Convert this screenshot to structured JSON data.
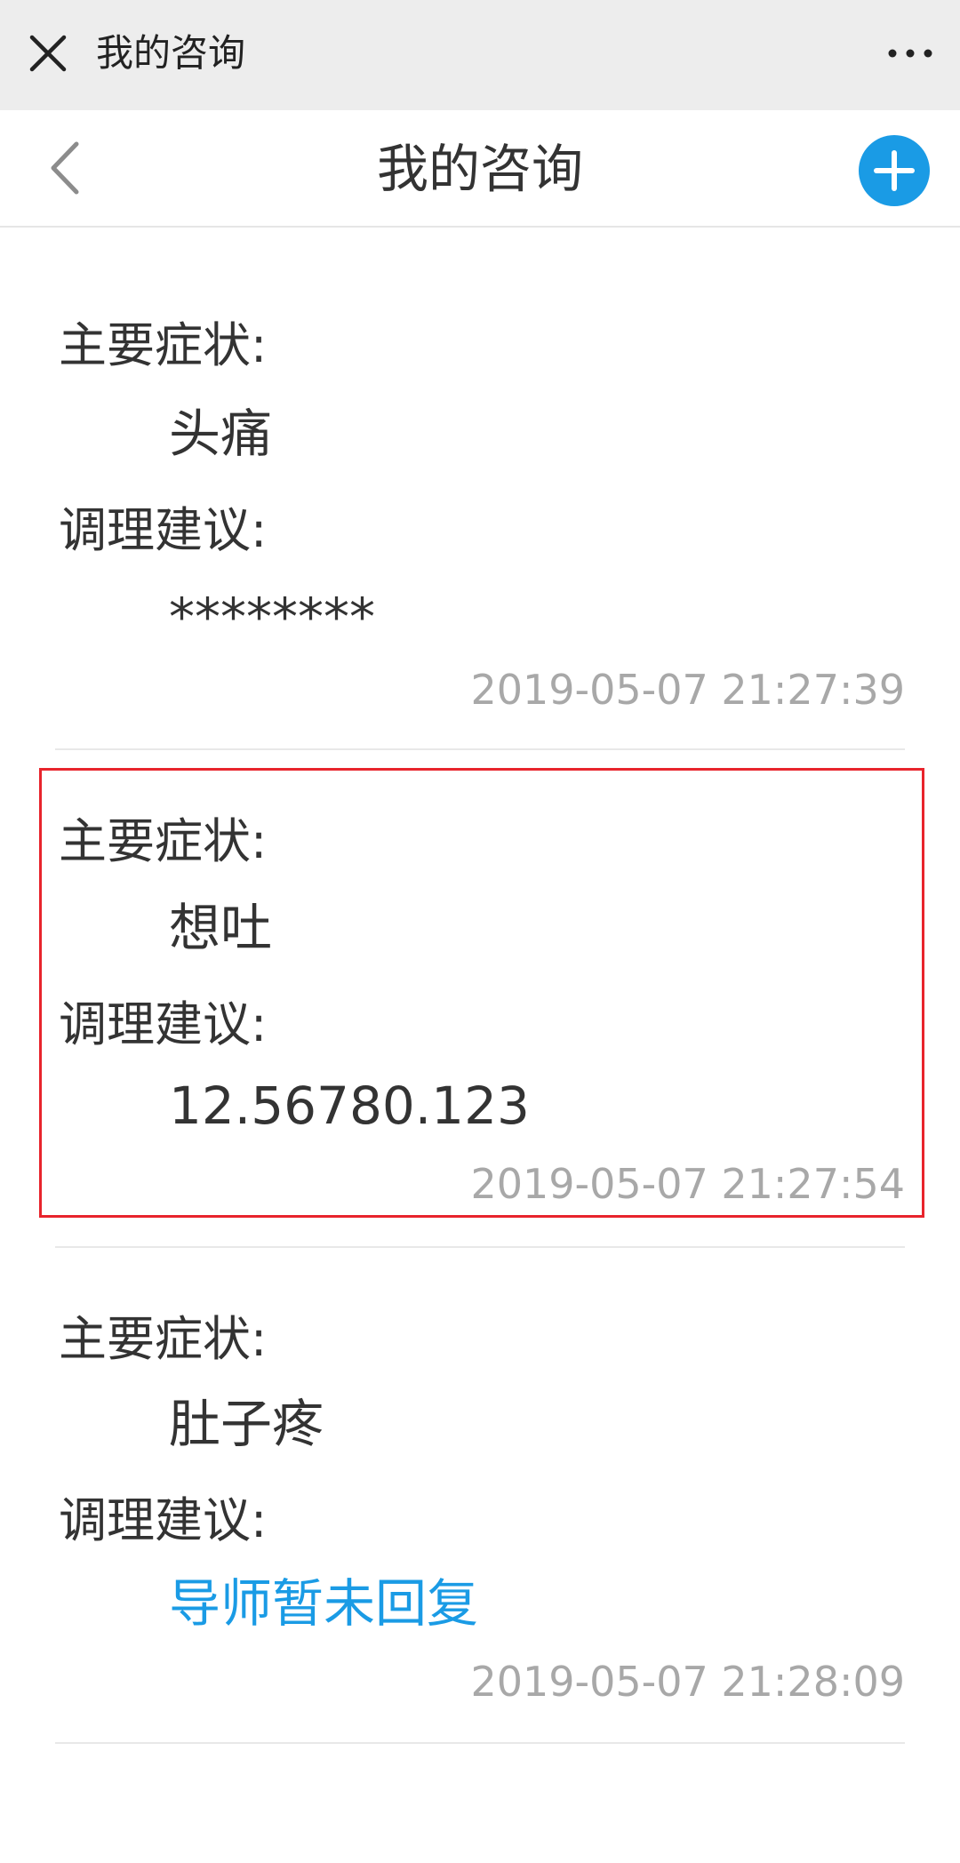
{
  "system_bar": {
    "title": "我的咨询",
    "close_icon": "close-icon",
    "more_icon": "more-dots-icon"
  },
  "header": {
    "title": "我的咨询",
    "back_icon": "chevron-left-icon",
    "add_icon": "plus-circle-icon"
  },
  "colors": {
    "accent": "#1a9be5",
    "highlight": "#e8242c",
    "timestamp": "#a8a8a8"
  },
  "records": [
    {
      "symptom_label": "主要症状:",
      "symptom": "头痛",
      "advice_label": "调理建议:",
      "advice": "********",
      "time": "2019-05-07 21:27:39"
    },
    {
      "symptom_label": "主要症状:",
      "symptom": "想吐",
      "advice_label": "调理建议:",
      "advice": "12.56780.123",
      "time": "2019-05-07 21:27:54"
    },
    {
      "symptom_label": "主要症状:",
      "symptom": "肚子疼",
      "advice_label": "调理建议:",
      "advice": "导师暂未回复",
      "time": "2019-05-07 21:28:09"
    }
  ]
}
